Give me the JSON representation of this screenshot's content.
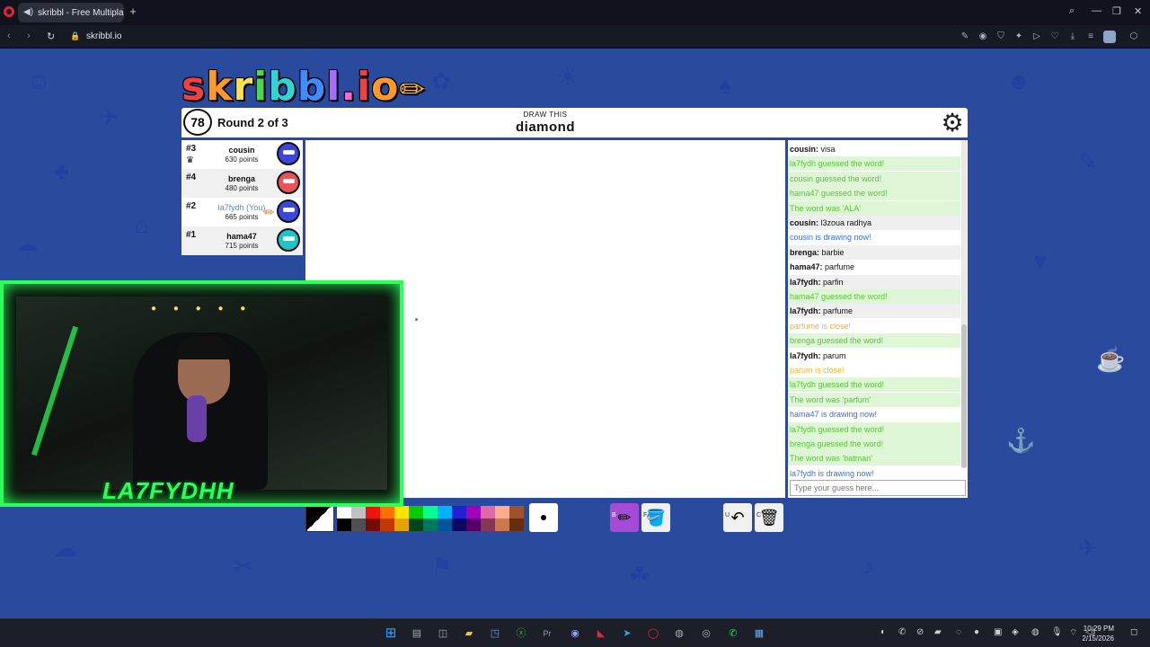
{
  "browser": {
    "tab_title": "skribbl - Free Multipla",
    "url": "skribbl.io"
  },
  "game": {
    "logo_text": "skribbl.io",
    "timer": "78",
    "round_text": "Round 2 of 3",
    "draw_label": "DRAW THIS",
    "word": "diamond"
  },
  "players": [
    {
      "rank": "#3",
      "name": "cousin",
      "points": "630 points",
      "avatar_color": "#3c46d8",
      "is_you": false,
      "crown": true
    },
    {
      "rank": "#4",
      "name": "brenga",
      "points": "480 points",
      "avatar_color": "#e8545a",
      "is_you": false,
      "crown": false
    },
    {
      "rank": "#2",
      "name": "la7fydh (You)",
      "points": "665 points",
      "avatar_color": "#3c46d8",
      "is_you": true,
      "crown": false
    },
    {
      "rank": "#1",
      "name": "hama47",
      "points": "715 points",
      "avatar_color": "#20c4c4",
      "is_you": false,
      "crown": false
    }
  ],
  "chat": {
    "input_placeholder": "Type your guess here...",
    "messages": [
      {
        "author": "cousin:",
        "text": " visa",
        "style": "normal"
      },
      {
        "author": "",
        "text": "la7fydh guessed the word!",
        "style": "green"
      },
      {
        "author": "",
        "text": "cousin guessed the word!",
        "style": "green"
      },
      {
        "author": "",
        "text": "hama47 guessed the word!",
        "style": "green"
      },
      {
        "author": "",
        "text": "The word was 'ALA'",
        "style": "green"
      },
      {
        "author": "cousin:",
        "text": " l3zoua radhya",
        "style": "normal"
      },
      {
        "author": "",
        "text": "cousin is drawing now!",
        "style": "blue"
      },
      {
        "author": "brenga:",
        "text": " barbie",
        "style": "normal"
      },
      {
        "author": "hama47:",
        "text": " parfume",
        "style": "normal"
      },
      {
        "author": "la7fydh:",
        "text": " parfin",
        "style": "normal"
      },
      {
        "author": "",
        "text": "hama47 guessed the word!",
        "style": "green"
      },
      {
        "author": "la7fydh:",
        "text": " parfume",
        "style": "normal"
      },
      {
        "author": "",
        "text": "parfume is close!",
        "style": "yellow"
      },
      {
        "author": "",
        "text": "brenga guessed the word!",
        "style": "green"
      },
      {
        "author": "la7fydh:",
        "text": " parum",
        "style": "normal"
      },
      {
        "author": "",
        "text": "parum is close!",
        "style": "yellow"
      },
      {
        "author": "",
        "text": "la7fydh guessed the word!",
        "style": "green"
      },
      {
        "author": "",
        "text": "The word was 'parfum'",
        "style": "green"
      },
      {
        "author": "",
        "text": "hama47 is drawing now!",
        "style": "blue"
      },
      {
        "author": "",
        "text": "la7fydh guessed the word!",
        "style": "green"
      },
      {
        "author": "",
        "text": "brenga guessed the word!",
        "style": "green"
      },
      {
        "author": "",
        "text": "The word was 'batman'",
        "style": "green"
      },
      {
        "author": "",
        "text": "la7fydh is drawing now!",
        "style": "blue"
      }
    ]
  },
  "toolbar": {
    "swatches_top": [
      "#ffffff",
      "#c1c1c1",
      "#ef130b",
      "#ff7100",
      "#ffe400",
      "#00cc00",
      "#00ff91",
      "#00b2ff",
      "#231fd3",
      "#a300ba",
      "#df69a7",
      "#ffac8e",
      "#a0522d"
    ],
    "swatches_bottom": [
      "#000000",
      "#505050",
      "#740b07",
      "#c23800",
      "#e8a200",
      "#004619",
      "#00785d",
      "#00569e",
      "#0e0865",
      "#550069",
      "#873554",
      "#cc774d",
      "#63300d"
    ],
    "brush_key": "B",
    "fill_key": "F",
    "undo_key": "U",
    "clear_key": "C"
  },
  "stream": {
    "overlay_name": "LA7FYDHH"
  },
  "taskbar": {
    "time": "10:29 PM",
    "date": "2/15/2026"
  }
}
